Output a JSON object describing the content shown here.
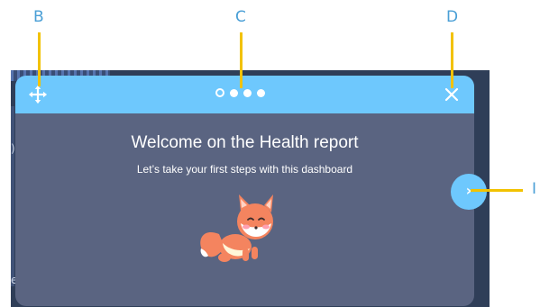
{
  "background": {
    "left_glyph_top": ")",
    "left_glyph_bottom": "e"
  },
  "modal": {
    "title": "Welcome on the Health report",
    "subtitle": "Let’s take your first steps with this dashboard",
    "step_count": 4,
    "current_step": 1,
    "colors": {
      "header": "#6ec8fd",
      "body": "#5a6481",
      "text": "#ffffff"
    },
    "icons": {
      "move": "move-icon",
      "close": "close-icon",
      "mascot": "fox-mascot-illustration"
    }
  },
  "next_button": {
    "label": "›"
  },
  "callouts": {
    "b": "B",
    "c": "C",
    "d": "D",
    "e": "I",
    "color": "#f2c200"
  }
}
